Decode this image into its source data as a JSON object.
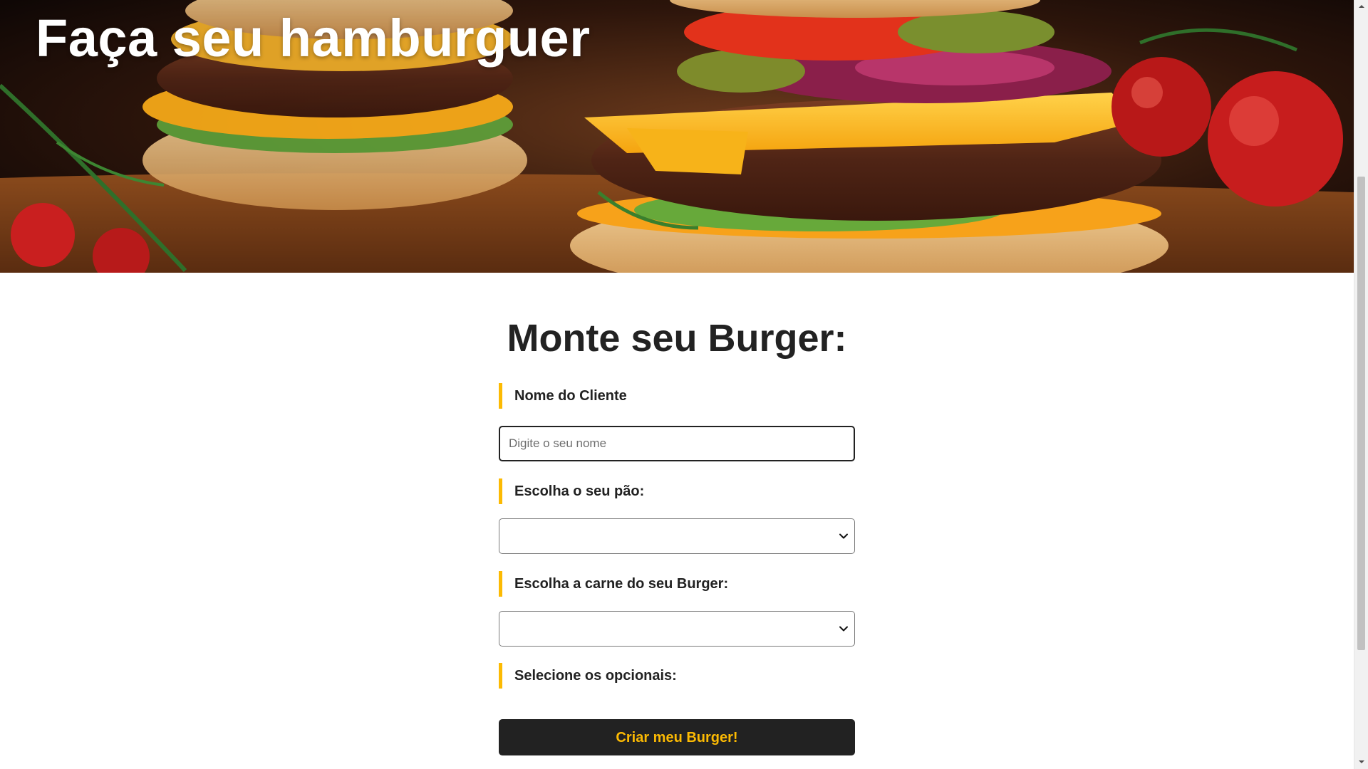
{
  "hero": {
    "title": "Faça seu hamburguer",
    "image": "burger-photo"
  },
  "form": {
    "title": "Monte seu Burger:",
    "name_field": {
      "label": "Nome do Cliente",
      "placeholder": "Digite o seu nome",
      "value": ""
    },
    "bread_field": {
      "label": "Escolha o seu pão:",
      "selected": ""
    },
    "meat_field": {
      "label": "Escolha a carne do seu Burger:",
      "selected": ""
    },
    "optionals_field": {
      "label": "Selecione os opcionais:"
    },
    "submit_label": "Criar meu Burger!"
  },
  "colors": {
    "accent": "#fcba03",
    "dark": "#222222",
    "background": "#ffffff"
  },
  "icons": {
    "select_arrow": "chevron-down-icon",
    "scroll_up": "scroll-up-arrow-icon",
    "scroll_down": "scroll-down-arrow-icon"
  }
}
